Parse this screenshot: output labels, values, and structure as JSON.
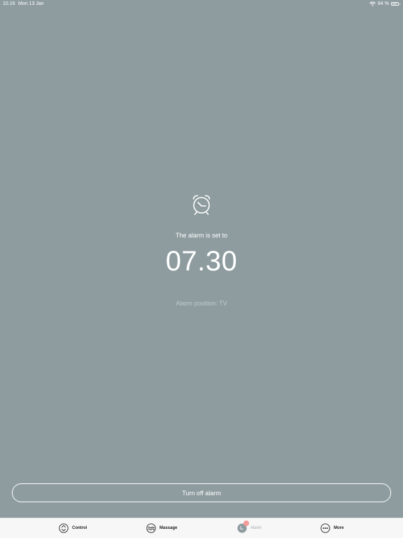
{
  "status_bar": {
    "time": "10.16",
    "date": "Mon 13 Jan",
    "battery": "84 %",
    "battery_level": 0.84,
    "icons": [
      "wifi-icon",
      "battery-icon"
    ]
  },
  "alarm": {
    "icon": "alarm-clock-icon",
    "caption": "The alarm is set to",
    "time": "07.30",
    "position": "Alarm position: TV"
  },
  "actions": {
    "turn_off_label": "Turn off alarm"
  },
  "tabs": [
    {
      "label": "Control",
      "icon": "control-icon",
      "active": false
    },
    {
      "label": "Massage",
      "icon": "massage-icon",
      "active": false
    },
    {
      "label": "Alarm",
      "icon": "alarm-tab-icon",
      "active": true
    },
    {
      "label": "More",
      "icon": "more-icon",
      "active": false
    }
  ],
  "colors": {
    "background": "#8e9c9f",
    "tab_bar": "#f7f7f7",
    "badge": "#f59c9a",
    "text_light": "#ffffff",
    "text_muted": "#c2cacc"
  }
}
